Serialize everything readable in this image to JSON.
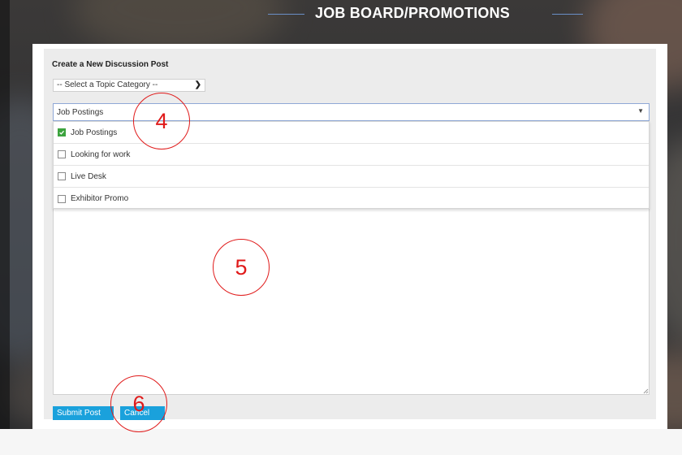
{
  "header": {
    "title": "JOB BOARD/PROMOTIONS"
  },
  "form": {
    "heading": "Create a New Discussion Post",
    "topic_select": {
      "value": "-- Select a Topic Category --",
      "icon": "chevron-down-icon"
    },
    "category_select": {
      "value": "Job Postings",
      "options": [
        {
          "label": "Job Postings",
          "checked": true
        },
        {
          "label": "Looking for work",
          "checked": false
        },
        {
          "label": "Live Desk",
          "checked": false
        },
        {
          "label": "Exhibitor Promo",
          "checked": false
        }
      ]
    },
    "body_value": "",
    "submit_label": "Submit Post",
    "cancel_label": "Cancel"
  },
  "annotations": [
    "4",
    "5",
    "6"
  ],
  "colors": {
    "button": "#1aa1dc",
    "annotation": "#e01a1a",
    "checkbox_checked": "#3ca33e",
    "title_line": "#6a8fc7"
  }
}
